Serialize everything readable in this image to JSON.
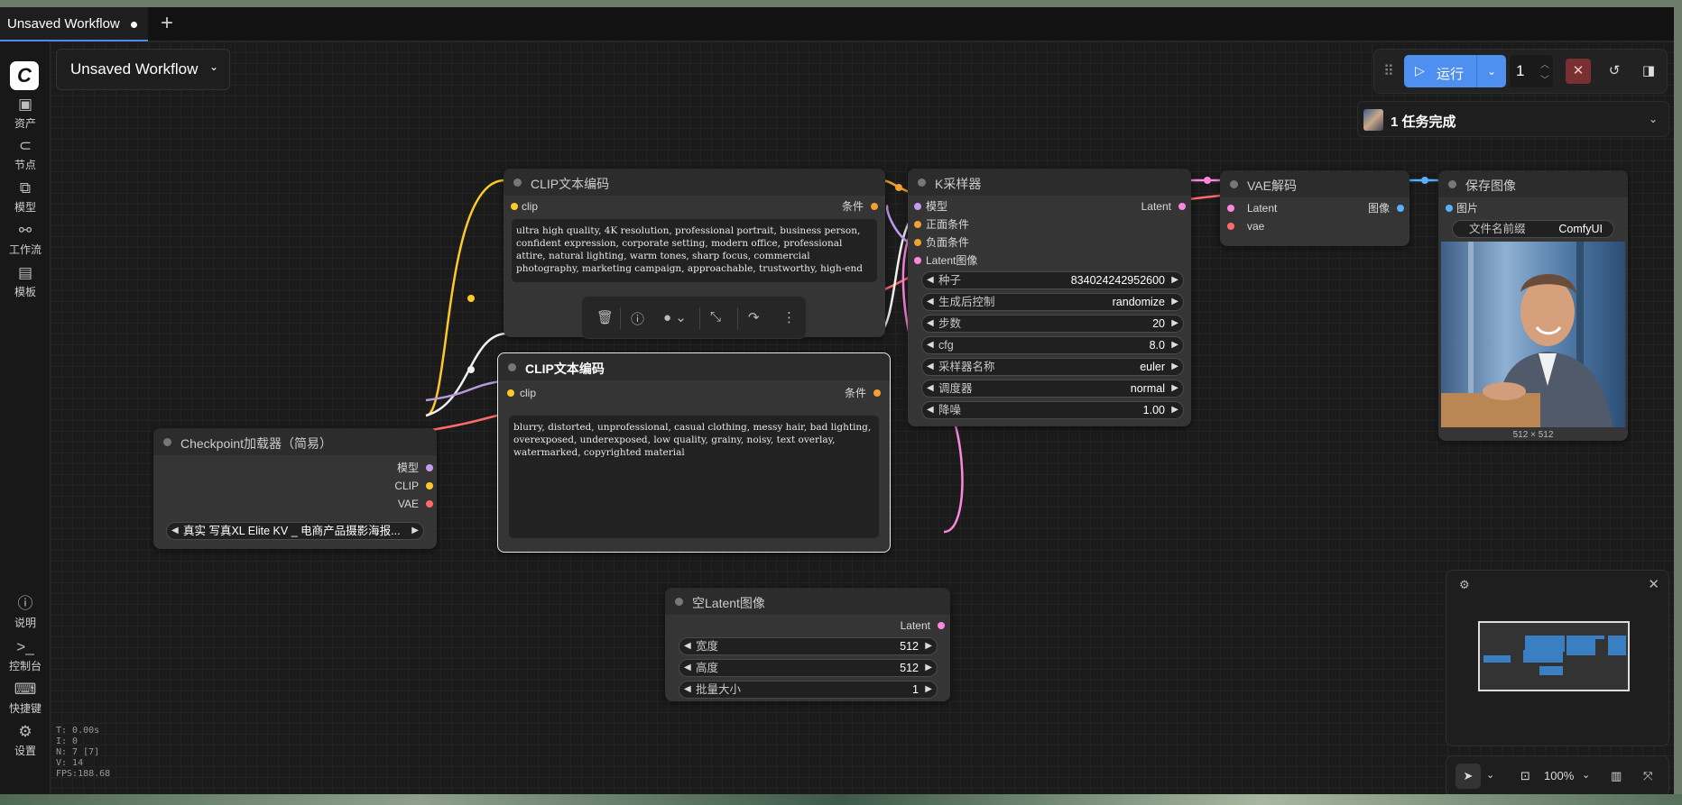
{
  "tab": {
    "title": "Unsaved Workflow",
    "add": "+"
  },
  "sidebar": {
    "logo": "C",
    "items": [
      {
        "label": "资产",
        "icon": "image-icon"
      },
      {
        "label": "节点",
        "icon": "node-icon"
      },
      {
        "label": "模型",
        "icon": "model-icon"
      },
      {
        "label": "工作流",
        "icon": "workflow-icon"
      },
      {
        "label": "模板",
        "icon": "template-icon"
      }
    ],
    "bottom_items": [
      {
        "label": "说明",
        "icon": "help-icon"
      },
      {
        "label": "控制台",
        "icon": "terminal-icon"
      },
      {
        "label": "快捷键",
        "icon": "keyboard-icon"
      },
      {
        "label": "设置",
        "icon": "settings-icon"
      }
    ]
  },
  "workflow_title": "Unsaved Workflow",
  "run_bar": {
    "run_label": "运行",
    "batch_count": "1"
  },
  "queue": {
    "status": "1 任务完成"
  },
  "stats": [
    "T: 0.00s",
    "I: 0",
    "N: 7 [7]",
    "V: 14",
    "FPS:188.68"
  ],
  "nodes": {
    "clip_pos": {
      "title": "CLIP文本编码",
      "input": "clip",
      "output": "条件",
      "text": "ultra high quality, 4K resolution, professional portrait, business person, confident expression, corporate setting, modern office, professional attire, natural lighting, warm tones, sharp focus, commercial photography, marketing campaign, approachable, trustworthy, high-end"
    },
    "clip_neg": {
      "title": "CLIP文本编码",
      "input": "clip",
      "output": "条件",
      "text": "blurry, distorted, unprofessional, casual clothing, messy hair, bad lighting, overexposed, underexposed, low quality, grainy, noisy, text overlay, watermarked, copyrighted material"
    },
    "checkpoint": {
      "title": "Checkpoint加载器（简易）",
      "outputs": [
        "模型",
        "CLIP",
        "VAE"
      ],
      "ckpt": "真实 写真XL Elite KV _ 电商产品摄影海报..."
    },
    "ksampler": {
      "title": "K采样器",
      "inputs": [
        "模型",
        "正面条件",
        "负面条件",
        "Latent图像"
      ],
      "output": "Latent",
      "widgets": [
        {
          "name": "种子",
          "value": "834024242952600"
        },
        {
          "name": "生成后控制",
          "value": "randomize"
        },
        {
          "name": "步数",
          "value": "20"
        },
        {
          "name": "cfg",
          "value": "8.0"
        },
        {
          "name": "采样器名称",
          "value": "euler"
        },
        {
          "name": "调度器",
          "value": "normal"
        },
        {
          "name": "降噪",
          "value": "1.00"
        }
      ]
    },
    "vae_decode": {
      "title": "VAE解码",
      "inputs": [
        "Latent",
        "vae"
      ],
      "output": "图像"
    },
    "save_image": {
      "title": "保存图像",
      "input": "图片",
      "prefix_label": "文件名前缀",
      "prefix_value": "ComfyUI",
      "size": "512 × 512"
    },
    "empty_latent": {
      "title": "空Latent图像",
      "output": "Latent",
      "widgets": [
        {
          "name": "宽度",
          "value": "512"
        },
        {
          "name": "高度",
          "value": "512"
        },
        {
          "name": "批量大小",
          "value": "1"
        }
      ]
    }
  },
  "bottom_tools": {
    "zoom": "100%"
  }
}
